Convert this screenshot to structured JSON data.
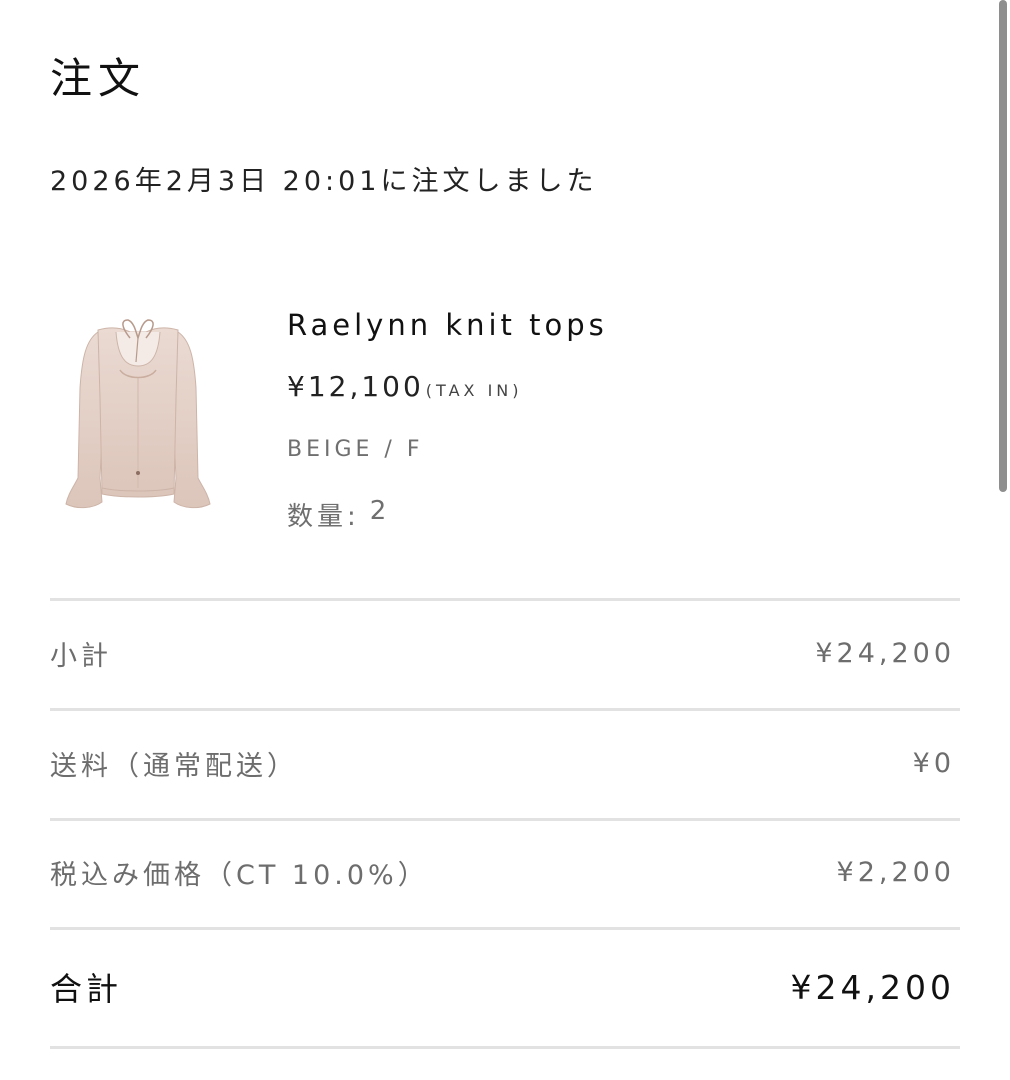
{
  "order": {
    "title": "注文",
    "date_text": "2026年2月3日 20:01に注文しました"
  },
  "product": {
    "name": "Raelynn knit tops",
    "price": "¥12,100",
    "tax_note": "(TAX IN)",
    "variant": "BEIGE / F",
    "quantity_label": "数量:",
    "quantity_value": "2",
    "image_icon": "knit-top-image",
    "image_color": "#e8d6cd"
  },
  "summary": {
    "subtotal_label": "小計",
    "subtotal_value": "¥24,200",
    "shipping_label": "送料（通常配送）",
    "shipping_value": "¥0",
    "tax_label": "税込み価格（CT 10.0%）",
    "tax_value": "¥2,200",
    "total_label": "合計",
    "total_value": "¥24,200"
  },
  "colors": {
    "divider": "#e2e2e2",
    "muted_text": "#6d6d6d",
    "primary_text": "#111111"
  }
}
